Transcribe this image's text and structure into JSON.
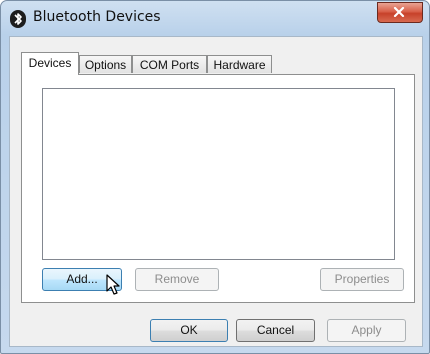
{
  "window": {
    "title": "Bluetooth Devices",
    "close_label": "X"
  },
  "tabs": [
    {
      "label": "Devices",
      "active": true
    },
    {
      "label": "Options",
      "active": false
    },
    {
      "label": "COM Ports",
      "active": false
    },
    {
      "label": "Hardware",
      "active": false
    }
  ],
  "devices_panel": {
    "device_list": [],
    "add_label": "Add...",
    "remove_label": "Remove",
    "properties_label": "Properties"
  },
  "footer": {
    "ok_label": "OK",
    "cancel_label": "Cancel",
    "apply_label": "Apply"
  },
  "colors": {
    "frame": "#b9d1ea",
    "close_button": "#c7412a",
    "hover_blue": "#3c7fb1"
  }
}
